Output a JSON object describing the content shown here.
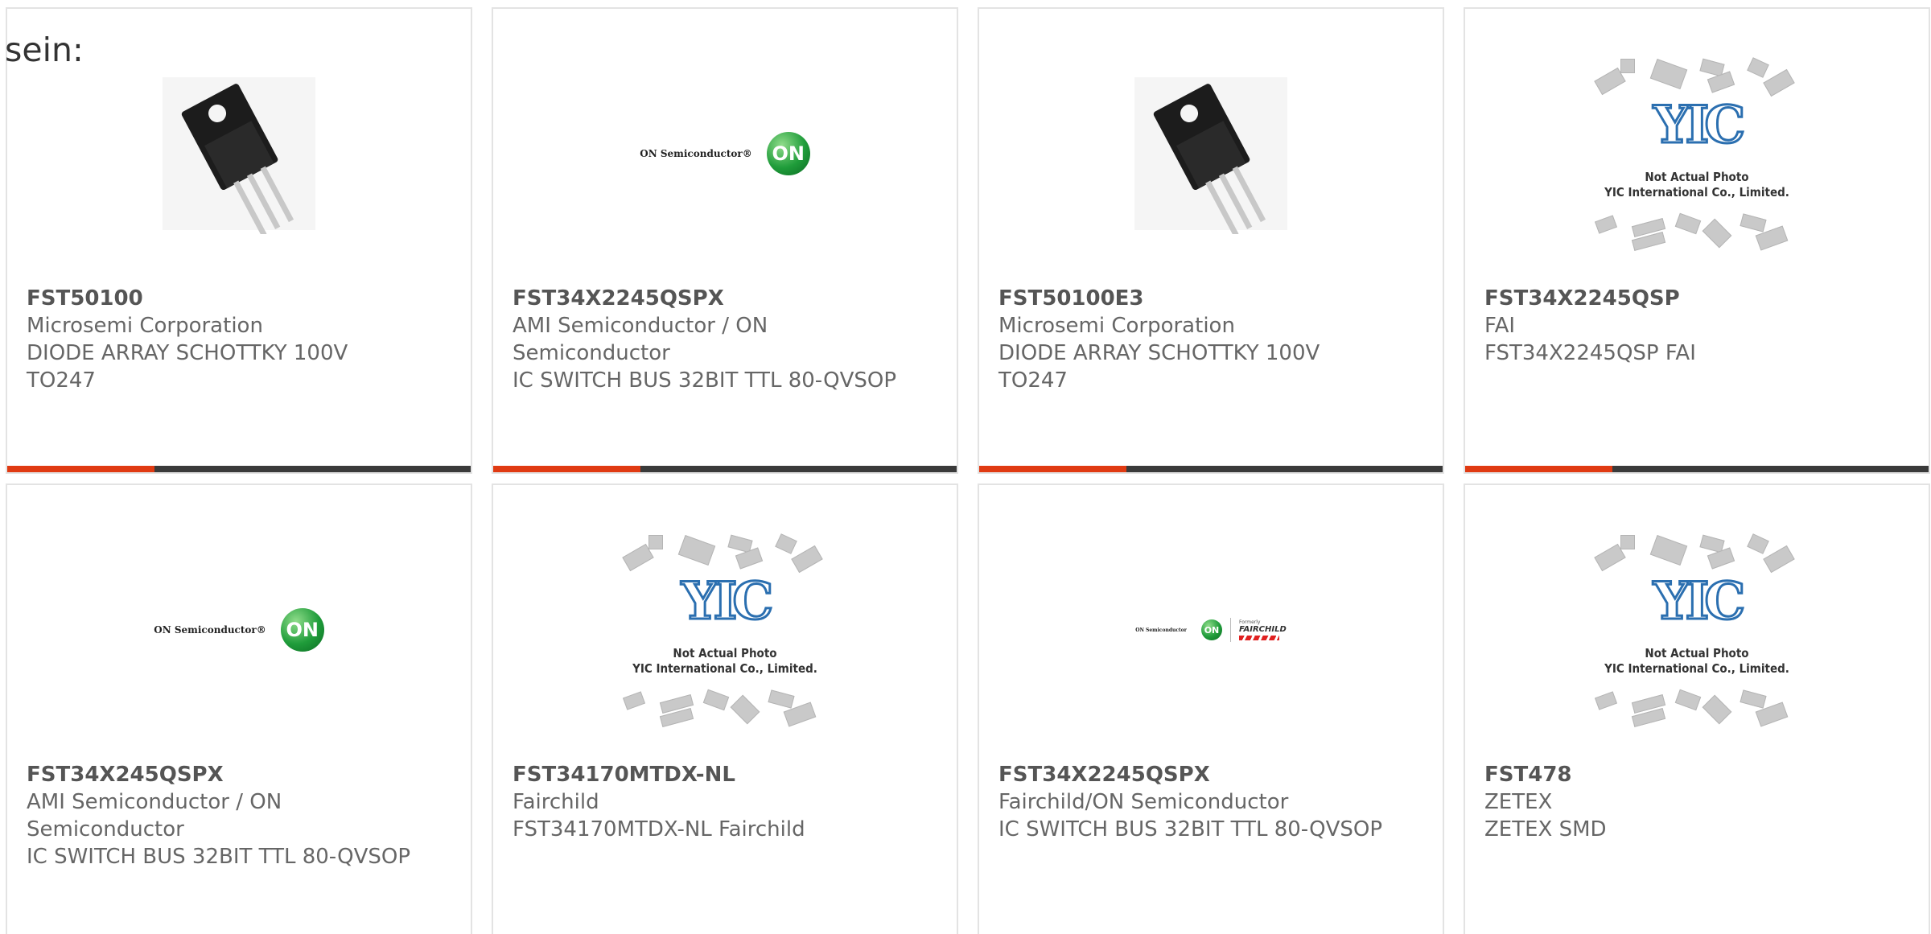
{
  "lead_text": "sein:",
  "colors": {
    "accent": "#e03a12",
    "bar": "#3a3a3a",
    "card_border": "#e3e3e3"
  },
  "cards": [
    {
      "image": "to247-diode-photo",
      "part_number": "FST50100",
      "manufacturer": "Microsemi Corporation",
      "description": "DIODE ARRAY SCHOTTKY 100V TO247"
    },
    {
      "image": "on-semiconductor-logo",
      "logo_text": "ON Semiconductor®",
      "badge": "ON",
      "part_number": "FST34X2245QSPX",
      "manufacturer": "AMI Semiconductor / ON Semiconductor",
      "description": "IC SWITCH BUS 32BIT TTL 80-QVSOP"
    },
    {
      "image": "to247-diode-photo",
      "part_number": "FST50100E3",
      "manufacturer": "Microsemi Corporation",
      "description": "DIODE ARRAY SCHOTTKY 100V TO247"
    },
    {
      "image": "yic-placeholder",
      "placeholder_line1": "Not Actual Photo",
      "placeholder_line2": "YIC International Co., Limited.",
      "placeholder_logo": "YIC",
      "part_number": "FST34X2245QSP",
      "manufacturer": "FAI",
      "description": "FST34X2245QSP FAI"
    },
    {
      "image": "on-semiconductor-logo",
      "logo_text": "ON Semiconductor®",
      "badge": "ON",
      "part_number": "FST34X245QSPX",
      "manufacturer": "AMI Semiconductor / ON Semiconductor",
      "description": "IC SWITCH BUS 32BIT TTL 80-QVSOP"
    },
    {
      "image": "yic-placeholder",
      "placeholder_line1": "Not Actual Photo",
      "placeholder_line2": "YIC International Co., Limited.",
      "placeholder_logo": "YIC",
      "part_number": "FST34170MTDX-NL",
      "manufacturer": "Fairchild",
      "description": "FST34170MTDX-NL Fairchild"
    },
    {
      "image": "on-fairchild-logo",
      "logo_text": "ON Semiconductor",
      "badge": "ON",
      "formerly": "Formerly",
      "brand2": "FAIRCHILD",
      "part_number": "FST34X2245QSPX",
      "manufacturer": "Fairchild/ON Semiconductor",
      "description": "IC SWITCH BUS 32BIT TTL 80-QVSOP"
    },
    {
      "image": "yic-placeholder",
      "placeholder_line1": "Not Actual Photo",
      "placeholder_line2": "YIC International Co., Limited.",
      "placeholder_logo": "YIC",
      "part_number": "FST478",
      "manufacturer": "ZETEX",
      "description": "ZETEX SMD"
    }
  ]
}
